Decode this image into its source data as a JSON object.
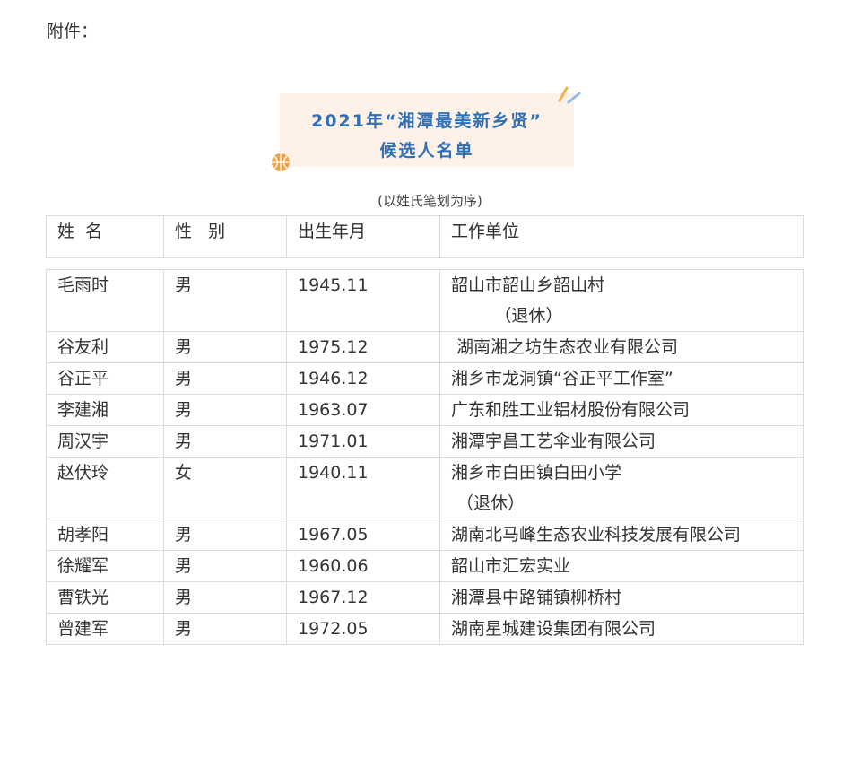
{
  "attachment_label": "附件：",
  "banner": {
    "line1": "2021年“湘潭最美新乡贤”",
    "line2": "候选人名单"
  },
  "note": "(以姓氏笔划为序)",
  "headers": [
    "姓  名",
    "性   别",
    "出生年月",
    "工作单位"
  ],
  "rows": [
    {
      "name": "毛雨时",
      "gender": "男",
      "birth": "1945.11",
      "unit": "韶山市韶山乡韶山村",
      "unit2": "        （退休）"
    },
    {
      "name": "谷友利",
      "gender": "男",
      "birth": "1975.12",
      "unit": " 湖南湘之坊生态农业有限公司",
      "unit2": ""
    },
    {
      "name": "谷正平",
      "gender": "男",
      "birth": "1946.12",
      "unit": "湘乡市龙洞镇“谷正平工作室”",
      "unit2": ""
    },
    {
      "name": "李建湘",
      "gender": "男",
      "birth": "1963.07",
      "unit": "广东和胜工业铝材股份有限公司",
      "unit2": ""
    },
    {
      "name": "周汉宇",
      "gender": "男",
      "birth": "1971.01",
      "unit": "湘潭宇昌工艺伞业有限公司",
      "unit2": ""
    },
    {
      "name": "赵伏玲",
      "gender": "女",
      "birth": "1940.11",
      "unit": "湘乡市白田镇白田小学",
      "unit2": " （退休）"
    },
    {
      "name": "胡孝阳",
      "gender": "男",
      "birth": "1967.05",
      "unit": "湖南北马峰生态农业科技发展有限公司",
      "unit2": ""
    },
    {
      "name": "徐耀军",
      "gender": "男",
      "birth": "1960.06",
      "unit": "韶山市汇宏实业",
      "unit2": ""
    },
    {
      "name": "曹铁光",
      "gender": "男",
      "birth": "1967.12",
      "unit": "湘潭县中路铺镇柳桥村",
      "unit2": ""
    },
    {
      "name": "曾建军",
      "gender": "男",
      "birth": "1972.05",
      "unit": "湖南星城建设集团有限公司",
      "unit2": ""
    }
  ],
  "colors": {
    "banner_bg": "#fdf1e8",
    "banner_text": "#2f6fb5",
    "border": "#dcdcdc"
  },
  "icons": {
    "ball": "basketball-icon",
    "pencil": "pencil-icon"
  }
}
